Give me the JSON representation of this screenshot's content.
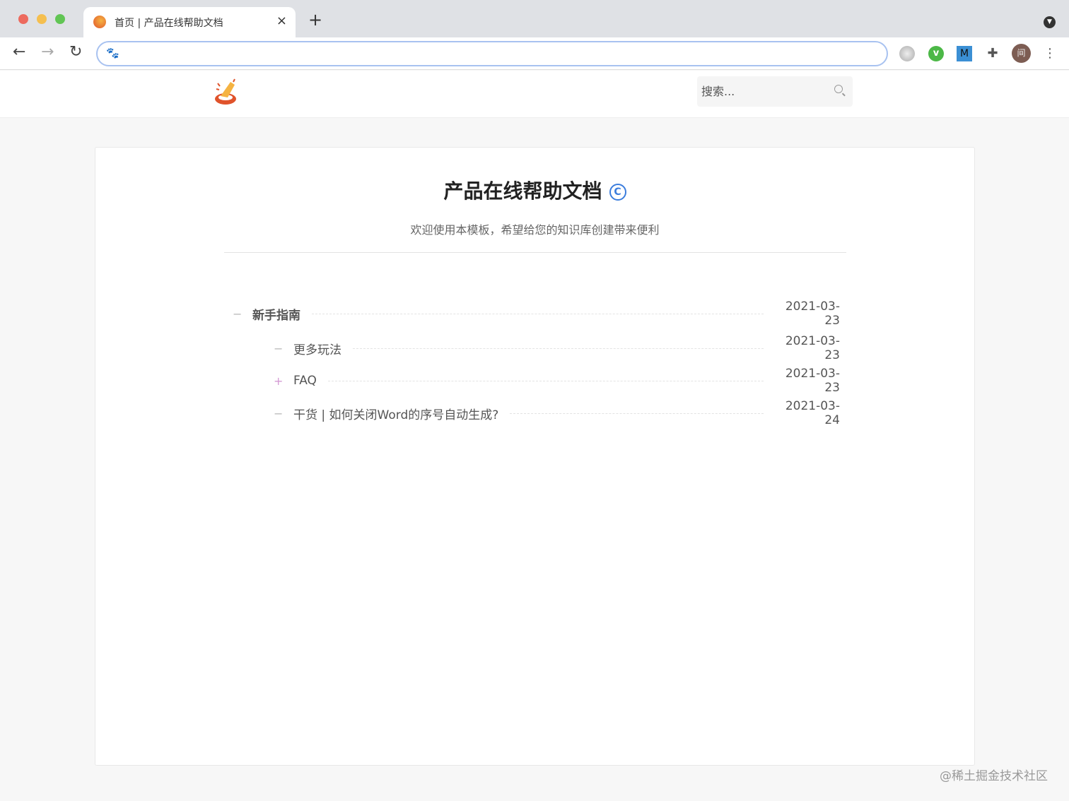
{
  "browser": {
    "tab_title": "首页 | 产品在线帮助文档",
    "close_icon": "×",
    "new_tab_icon": "+",
    "avatar_text": "间",
    "ext_m_label": "M"
  },
  "header": {
    "search_placeholder": "搜索..."
  },
  "main": {
    "title": "产品在线帮助文档",
    "title_badge": "C",
    "subtitle": "欢迎使用本模板，希望给您的知识库创建带来便利",
    "items": [
      {
        "mark": "−",
        "label": "新手指南",
        "date": "2021-03-23"
      },
      {
        "mark": "−",
        "label": "更多玩法",
        "date": "2021-03-23"
      },
      {
        "mark": "+",
        "label": "FAQ",
        "date": "2021-03-23"
      },
      {
        "mark": "−",
        "label": "干货 | 如何关闭Word的序号自动生成?",
        "date": "2021-03-24"
      }
    ]
  },
  "watermark": "@稀土掘金技术社区"
}
